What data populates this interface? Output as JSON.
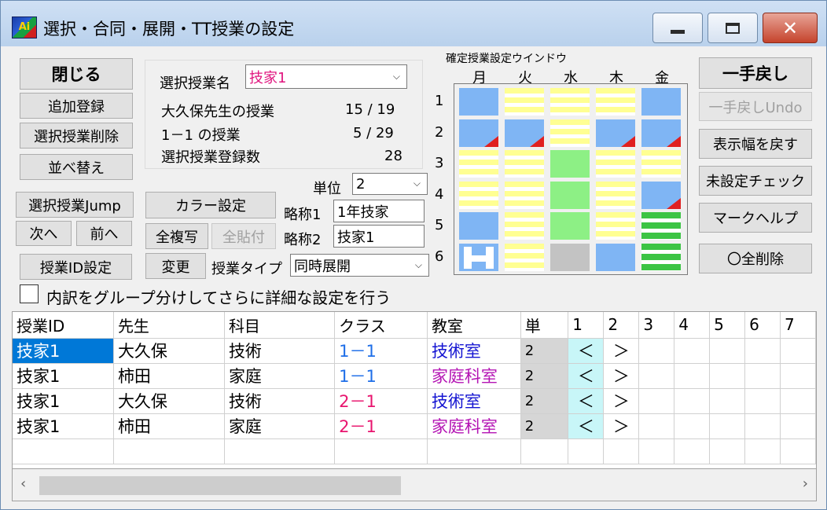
{
  "window": {
    "title": "選択・合同・展開・TT授業の設定",
    "icon_text": "Ai",
    "minimize_icon": "minimize-icon",
    "maximize_icon": "maximize-icon",
    "close_label": "✕"
  },
  "left_buttons": {
    "close": "閉じる",
    "add": "追加登録",
    "delete": "選択授業削除",
    "sort": "並べ替え",
    "jump": "選択授業Jump",
    "next": "次へ",
    "prev": "前へ",
    "id_setting": "授業ID設定"
  },
  "info": {
    "select_label": "選択授業名",
    "select_value": "技家1",
    "teacher_label": "大久保先生の授業",
    "teacher_value": "15 / 19",
    "class_label": "1－1 の授業",
    "class_value": "5 / 29",
    "count_label": "選択授業登録数",
    "count_value": "28"
  },
  "mid": {
    "unit_label": "単位",
    "unit_value": "2",
    "color_button": "カラー設定",
    "copy_all": "全複写",
    "paste_all": "全貼付",
    "abbr1_label": "略称1",
    "abbr1_value": "1年技家",
    "abbr2_label": "略称2",
    "abbr2_value": "技家1",
    "change_button": "変更",
    "type_label": "授業タイプ",
    "type_value": "同時展開"
  },
  "grid": {
    "title": "確定授業設定ウインドウ",
    "days": [
      "月",
      "火",
      "水",
      "木",
      "金"
    ],
    "periods": [
      "1",
      "2",
      "3",
      "4",
      "5",
      "6"
    ],
    "cells": [
      [
        "blue",
        "yellow",
        "yellow",
        "yellow",
        "blue"
      ],
      [
        "blue-tri",
        "blue-tri",
        "yellow",
        "blue-tri",
        "blue-tri"
      ],
      [
        "yellow",
        "yellow",
        "green",
        "yellow",
        "yellow"
      ],
      [
        "yellow",
        "yellow",
        "green",
        "yellow",
        "blue-tri"
      ],
      [
        "blue",
        "yellow",
        "green",
        "yellow",
        "gstripe"
      ],
      [
        "blue-h",
        "yellow",
        "gray",
        "blue",
        "gstripe"
      ]
    ],
    "colors": {
      "blue": "#7fb5f4",
      "green": "#8df085",
      "yellow": "#ffff92",
      "gray": "#c3c3c3",
      "red": "#e02020",
      "stripe_green": "#3cc444"
    }
  },
  "right_buttons": {
    "undo": "一手戻し",
    "undo_disabled": "一手戻しUndo",
    "reset_width": "表示幅を戻す",
    "unset_check": "未設定チェック",
    "mark_help": "マークヘルプ",
    "delete_all": "〇全削除"
  },
  "detail_checkbox": "内訳をグループ分けしてさらに詳細な設定を行う",
  "table": {
    "headers": [
      "授業ID",
      "先生",
      "科目",
      "クラス",
      "教室",
      "単",
      "1",
      "2",
      "3",
      "4",
      "5",
      "6",
      "7"
    ],
    "rows": [
      {
        "id": "技家1",
        "teacher": "大久保",
        "subject": "技術",
        "class": "1－1",
        "room": "技術室",
        "unit": "2",
        "p1": "＜",
        "p2": "＞"
      },
      {
        "id": "技家1",
        "teacher": "柿田",
        "subject": "家庭",
        "class": "1－1",
        "room": "家庭科室",
        "unit": "2",
        "p1": "＜",
        "p2": "＞"
      },
      {
        "id": "技家1",
        "teacher": "大久保",
        "subject": "技術",
        "class": "2－1",
        "room": "技術室",
        "unit": "2",
        "p1": "＜",
        "p2": "＞"
      },
      {
        "id": "技家1",
        "teacher": "柿田",
        "subject": "家庭",
        "class": "2－1",
        "room": "家庭科室",
        "unit": "2",
        "p1": "＜",
        "p2": "＞"
      }
    ],
    "colors": {
      "class_1": "#1e6ee8",
      "class_2": "#e8146e",
      "room_tech": "#1414d2",
      "room_home": "#b414b4",
      "selected": "#0078d7"
    }
  },
  "scrollbar": {
    "left_arrow": "‹",
    "right_arrow": "›"
  }
}
